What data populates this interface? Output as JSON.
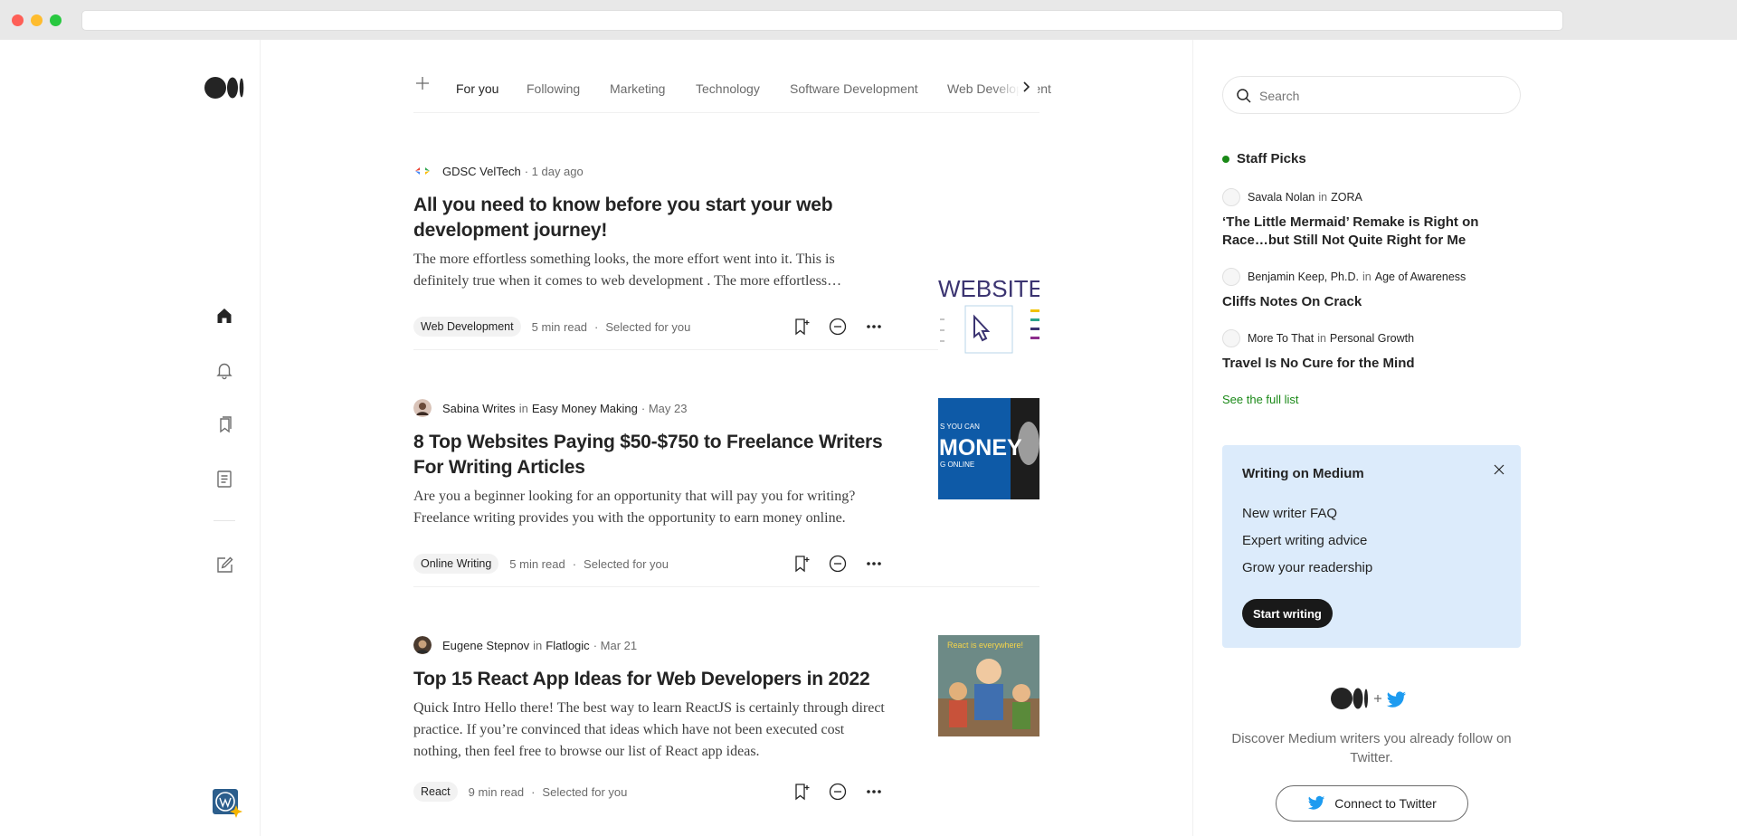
{
  "tabs": {
    "items": [
      "For you",
      "Following",
      "Marketing",
      "Technology",
      "Software Development",
      "Web Development"
    ]
  },
  "posts": [
    {
      "author": "GDSC VelTech",
      "publication": "",
      "date": "· 1 day ago",
      "title": "All you need to know before you start your web development journey!",
      "excerpt": "The more effortless something looks, the more effort went into it. This is definitely true when it comes to web development . The more effortless something looks, the more effort went into it.",
      "tag": "Web Development",
      "read_time": "5 min read",
      "selected": "Selected for you",
      "thumb_text": "WEBSITE"
    },
    {
      "author": "Sabina Writes",
      "publication": "Easy Money Making",
      "date": "· May 23",
      "title": "8 Top Websites Paying $50-$750 to Freelance Writers For Writing Articles",
      "excerpt": "Are you a beginner looking for an opportunity that will pay you for writing? Freelance writing provides you with the opportunity to earn money online.",
      "tag": "Online Writing",
      "read_time": "5 min read",
      "selected": "Selected for you",
      "thumb_text_small": "S YOU CAN",
      "thumb_text_big": "MONEY",
      "thumb_text_bottom": "G ONLINE"
    },
    {
      "author": "Eugene Stepnov",
      "publication": "Flatlogic",
      "date": "· Mar 21",
      "title": "Top 15 React App Ideas for Web Developers in 2022",
      "excerpt": "Quick Intro Hello there! The best way to learn ReactJS is certainly through direct practice. If you’re convinced that ideas which have not been executed cost nothing, then feel free to browse our list of React app ideas.",
      "tag": "React",
      "read_time": "9 min read",
      "selected": "Selected for you",
      "thumb_text": "React is everywhere!"
    }
  ],
  "sidebar": {
    "search_placeholder": "Search",
    "staff_picks_title": "Staff Picks",
    "picks": [
      {
        "author": "Savala Nolan",
        "in": "in",
        "publication": "ZORA",
        "title": "‘The Little Mermaid’ Remake is Right on Race…but Still Not Quite Right for Me"
      },
      {
        "author": "Benjamin Keep, Ph.D.",
        "in": "in",
        "publication": "Age of Awareness",
        "title": "Cliffs Notes On Crack"
      },
      {
        "author": "More To That",
        "in": "in",
        "publication": "Personal Growth",
        "title": "Travel Is No Cure for the Mind"
      }
    ],
    "see_full_list": "See the full list",
    "writing": {
      "title": "Writing on Medium",
      "links": [
        "New writer FAQ",
        "Expert writing advice",
        "Grow your readership"
      ],
      "button": "Start writing"
    },
    "twitter": {
      "text": "Discover Medium writers you already follow on Twitter.",
      "button": "Connect to Twitter"
    }
  },
  "colors": {
    "accent_green": "#1a8917",
    "writing_bg": "#dcebfb",
    "twitter_blue": "#1d9bf0"
  },
  "icons": [
    "medium-logo",
    "home-icon",
    "bell-icon",
    "bookmarks-icon",
    "stories-icon",
    "write-icon",
    "plus-icon",
    "chevron-right-icon",
    "search-icon",
    "save-icon",
    "show-less-icon",
    "more-icon",
    "close-icon",
    "twitter-icon"
  ]
}
